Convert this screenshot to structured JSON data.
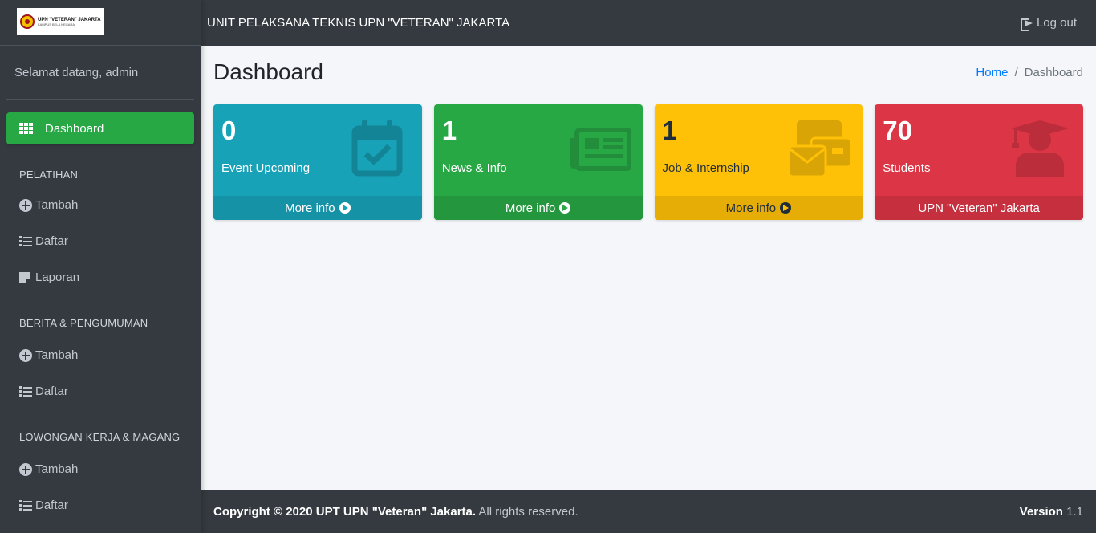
{
  "brand": {
    "logo_line1": "UPN \"VETERAN\" JAKARTA",
    "logo_line2": "KAMPUS BELA NEGARA"
  },
  "sidebar": {
    "welcome": "Selamat datang, admin",
    "dashboard_label": "Dashboard",
    "sections": [
      {
        "header": "PELATIHAN",
        "items": [
          {
            "label": "Tambah",
            "icon": "plus-circle-icon"
          },
          {
            "label": "Daftar",
            "icon": "list-icon"
          },
          {
            "label": "Laporan",
            "icon": "note-icon"
          }
        ]
      },
      {
        "header": "BERITA & PENGUMUMAN",
        "items": [
          {
            "label": "Tambah",
            "icon": "plus-circle-icon"
          },
          {
            "label": "Daftar",
            "icon": "list-icon"
          }
        ]
      },
      {
        "header": "LOWONGAN KERJA & MAGANG",
        "items": [
          {
            "label": "Tambah",
            "icon": "plus-circle-icon"
          },
          {
            "label": "Daftar",
            "icon": "list-icon"
          }
        ]
      }
    ]
  },
  "topbar": {
    "title": "UNIT PELAKSANA TEKNIS UPN \"VETERAN\" JAKARTA",
    "logout_label": "Log out"
  },
  "header": {
    "page_title": "Dashboard",
    "breadcrumb_home": "Home",
    "breadcrumb_sep": "/",
    "breadcrumb_current": "Dashboard"
  },
  "boxes": [
    {
      "value": "0",
      "label": "Event Upcoming",
      "footer": "More info",
      "color": "#17a2b8",
      "icon": "calendar-check-icon"
    },
    {
      "value": "1",
      "label": "News & Info",
      "footer": "More info",
      "color": "#28a745",
      "icon": "newspaper-icon"
    },
    {
      "value": "1",
      "label": "Job & Internship",
      "footer": "More info",
      "color": "#ffc107",
      "icon": "envelope-icon"
    },
    {
      "value": "70",
      "label": "Students",
      "footer": "UPN \"Veteran\" Jakarta",
      "color": "#dc3545",
      "icon": "graduate-icon"
    }
  ],
  "footer": {
    "copyright_bold": "Copyright © 2020 UPT UPN \"Veteran\" Jakarta.",
    "copyright_rest": "All rights reserved.",
    "version_label": "Version",
    "version_value": "1.1"
  }
}
